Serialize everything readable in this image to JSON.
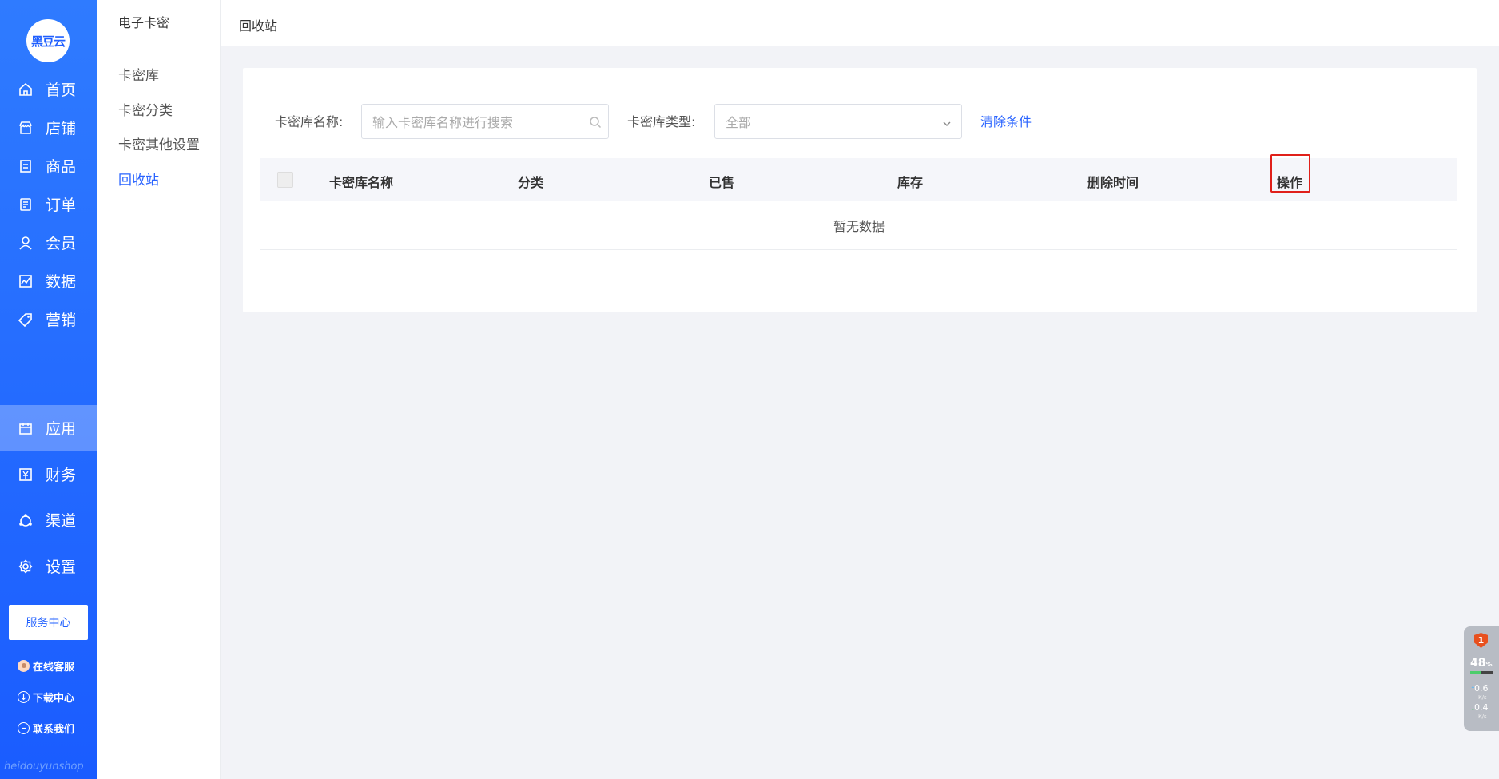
{
  "brand": {
    "logo_text": "黑豆云",
    "watermark": "heidouyunshop"
  },
  "nav": {
    "items": [
      {
        "label": "首页",
        "icon": "home-icon"
      },
      {
        "label": "店铺",
        "icon": "store-icon"
      },
      {
        "label": "商品",
        "icon": "goods-icon"
      },
      {
        "label": "订单",
        "icon": "order-icon"
      },
      {
        "label": "会员",
        "icon": "member-icon"
      },
      {
        "label": "数据",
        "icon": "chart-icon"
      },
      {
        "label": "营销",
        "icon": "tag-icon"
      },
      {
        "label": "应用",
        "icon": "app-box-icon"
      },
      {
        "label": "财务",
        "icon": "yuan-icon"
      },
      {
        "label": "渠道",
        "icon": "channel-icon"
      },
      {
        "label": "设置",
        "icon": "gear-icon"
      }
    ],
    "active": "应用",
    "service_button": "服务中心",
    "online_service": "在线客服",
    "download_center": "下载中心",
    "contact_us": "联系我们"
  },
  "subnav": {
    "title": "电子卡密",
    "items": [
      "卡密库",
      "卡密分类",
      "卡密其他设置",
      "回收站"
    ],
    "active": "回收站"
  },
  "topbar": {
    "breadcrumb": "回收站"
  },
  "filters": {
    "name_label": "卡密库名称:",
    "name_placeholder": "输入卡密库名称进行搜索",
    "type_label": "卡密库类型:",
    "type_value": "全部",
    "clear_label": "清除条件"
  },
  "table": {
    "columns": [
      "卡密库名称",
      "分类",
      "已售",
      "库存",
      "删除时间",
      "操作"
    ],
    "empty_text": "暂无数据"
  },
  "widget": {
    "badge": "1",
    "cpu_percent": "48",
    "cpu_unit": "%",
    "cpu_level": 0.48,
    "upload": "0.6",
    "download": "0.4",
    "speed_unit": "K/s"
  },
  "colors": {
    "nav_blue": "#1f5fff",
    "accent": "#2a64ff",
    "highlight_box": "#e0201a"
  }
}
